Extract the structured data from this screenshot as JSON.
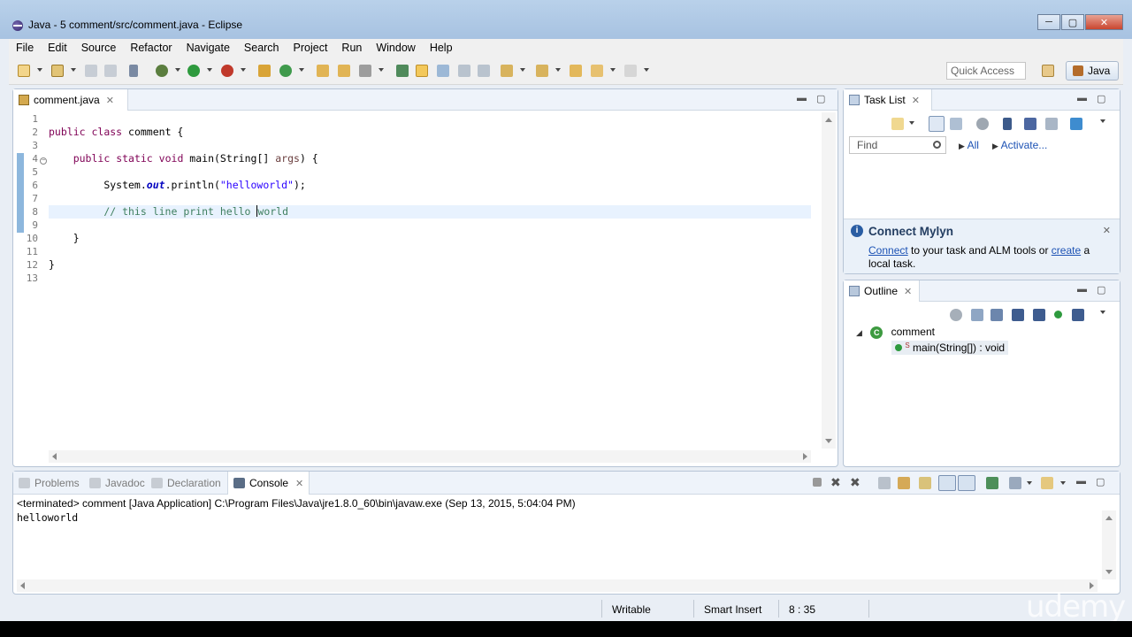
{
  "window": {
    "title": "Java - 5 comment/src/comment.java - Eclipse",
    "controls": [
      "─",
      "▢",
      "✕"
    ]
  },
  "menu": [
    "File",
    "Edit",
    "Source",
    "Refactor",
    "Navigate",
    "Search",
    "Project",
    "Run",
    "Window",
    "Help"
  ],
  "toolbar": {
    "quick_access_placeholder": "Quick Access",
    "perspective_label": "Java"
  },
  "editor": {
    "tab_label": "comment.java",
    "line_numbers": [
      "1",
      "2",
      "3",
      "4",
      "5",
      "6",
      "7",
      "8",
      "9",
      "10",
      "11",
      "12",
      "13"
    ],
    "current_line": 8,
    "code": {
      "l2_kw1": "public",
      "l2_kw2": "class",
      "l2_rest": " comment {",
      "l4_kw1": "public",
      "l4_kw2": "static",
      "l4_kw3": "void",
      "l4_mid": " main(String[] ",
      "l4_arg": "args",
      "l4_end": ") {",
      "l6_a": "System.",
      "l6_fld": "out",
      "l6_b": ".println(",
      "l6_str": "\"helloworld\"",
      "l6_end": ");",
      "l8_cmt_a": "// this line print hello ",
      "l8_cmt_b": "world",
      "l10": "}",
      "l12": "}"
    }
  },
  "tasklist": {
    "title": "Task List",
    "find_placeholder": "Find",
    "all_label": "All",
    "activate_label": "Activate...",
    "mylyn_title": "Connect Mylyn",
    "mylyn_connect": "Connect",
    "mylyn_text1": " to your task and ALM tools or ",
    "mylyn_create": "create",
    "mylyn_text2": " a local task."
  },
  "outline": {
    "title": "Outline",
    "class_name": "comment",
    "method": "main(String[]) : void"
  },
  "console": {
    "tabs": [
      "Problems",
      "Javadoc",
      "Declaration",
      "Console"
    ],
    "active_tab": "Console",
    "terminated_line": "<terminated> comment [Java Application] C:\\Program Files\\Java\\jre1.8.0_60\\bin\\javaw.exe (Sep 13, 2015, 5:04:04 PM)",
    "output": "helloworld"
  },
  "statusbar": {
    "writable": "Writable",
    "insert_mode": "Smart Insert",
    "position": "8 : 35"
  },
  "watermark": "udemy"
}
